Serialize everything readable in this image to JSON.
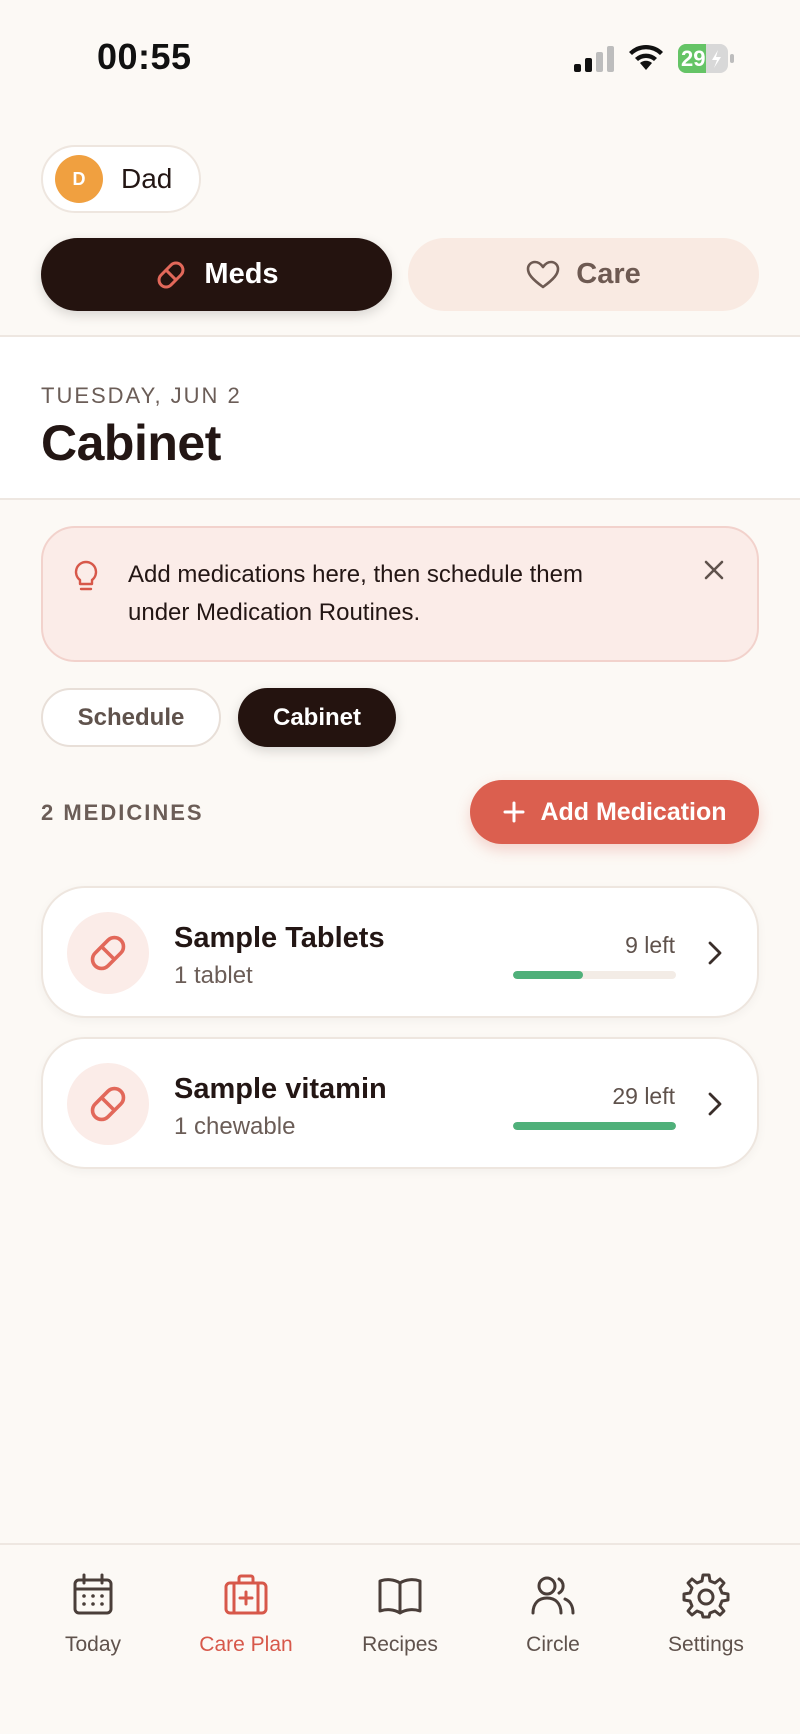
{
  "status_bar": {
    "time": "00:55",
    "battery": "29"
  },
  "profile": {
    "initial": "D",
    "name": "Dad"
  },
  "mode_tabs": [
    {
      "label": "Meds",
      "icon": "pill-icon",
      "active": true
    },
    {
      "label": "Care",
      "icon": "heart-icon",
      "active": false
    }
  ],
  "header": {
    "date": "TUESDAY, JUN 2",
    "title": "Cabinet"
  },
  "tip": {
    "text": "Add medications here, then schedule them under Medication Routines.",
    "icon": "lightbulb-icon"
  },
  "sub_tabs": [
    {
      "label": "Schedule",
      "active": false
    },
    {
      "label": "Cabinet",
      "active": true
    }
  ],
  "medicines": {
    "count_label": "2 MEDICINES",
    "add_label": "Add Medication",
    "items": [
      {
        "name": "Sample Tablets",
        "dose": "1 tablet",
        "left": "9 left",
        "supply_fraction": 0.43
      },
      {
        "name": "Sample vitamin",
        "dose": "1 chewable",
        "left": "29 left",
        "supply_fraction": 1.0
      }
    ]
  },
  "bottom_nav": [
    {
      "label": "Today",
      "icon": "calendar-icon",
      "active": false
    },
    {
      "label": "Care Plan",
      "icon": "medical-kit-icon",
      "active": true
    },
    {
      "label": "Recipes",
      "icon": "book-icon",
      "active": false
    },
    {
      "label": "Circle",
      "icon": "people-icon",
      "active": false
    },
    {
      "label": "Settings",
      "icon": "gear-icon",
      "active": false
    }
  ],
  "colors": {
    "background": "#FCF9F5",
    "dark": "#24130F",
    "accent": "#DB5F4F",
    "progress": "#4FB07A",
    "avatar": "#F0A040"
  }
}
